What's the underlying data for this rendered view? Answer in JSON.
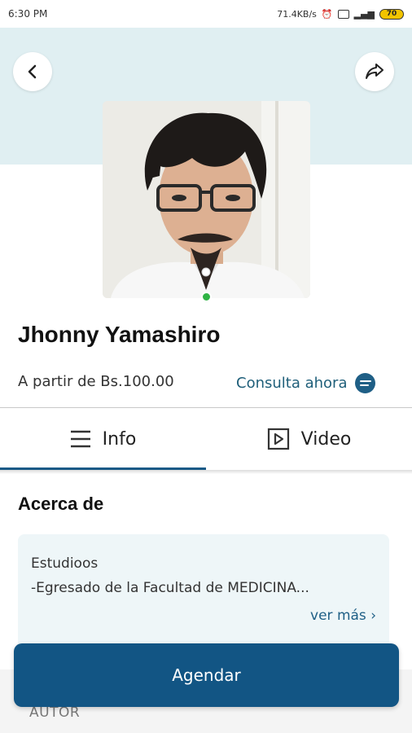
{
  "status_bar": {
    "time": "6:30 PM",
    "network_speed": "71.4KB/s",
    "battery_level": "70"
  },
  "header": {
    "background_color": "#e0eff2",
    "back_icon": "chevron-left-icon",
    "share_icon": "share-arrow-icon"
  },
  "doctor": {
    "name": "Jhonny Yamashiro",
    "online": true,
    "online_color": "#2fb344"
  },
  "pricing": {
    "price_text": "A partir de Bs.100.00",
    "consult_label": "Consulta ahora",
    "consult_icon": "chat-bubble-icon"
  },
  "tabs": [
    {
      "label": "Info",
      "icon": "menu-lines-icon",
      "active": true
    },
    {
      "label": "Video",
      "icon": "play-box-icon",
      "active": false
    }
  ],
  "about": {
    "title": "Acerca de",
    "heading": "Estudioos",
    "text": "-Egresado de la Facultad de MEDICINA...",
    "see_more": "ver más"
  },
  "author_label": "AUTOR",
  "cta": {
    "label": "Agendar",
    "color": "#125584"
  }
}
